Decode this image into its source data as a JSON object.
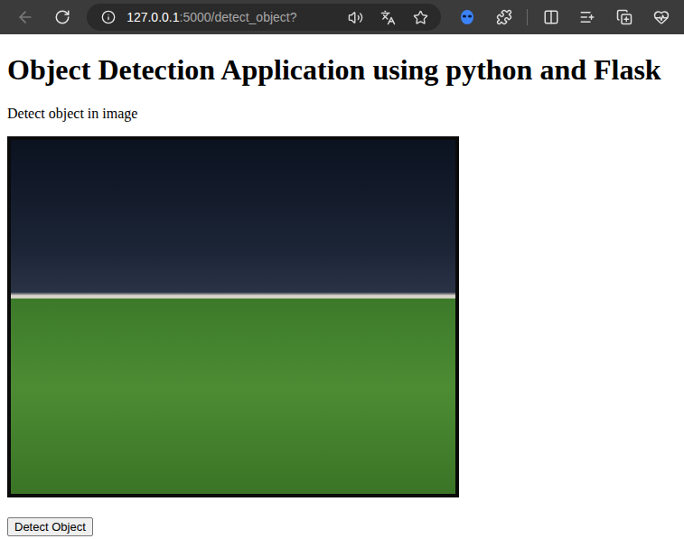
{
  "browser": {
    "back": {
      "disabled": true
    },
    "address": {
      "host": "127.0.0.1",
      "path": ":5000/detect_object?"
    },
    "favorite": {
      "on": false
    }
  },
  "page": {
    "heading": "Object Detection Application using python and Flask",
    "subtitle": "Detect object in image",
    "button": "Detect Object"
  }
}
